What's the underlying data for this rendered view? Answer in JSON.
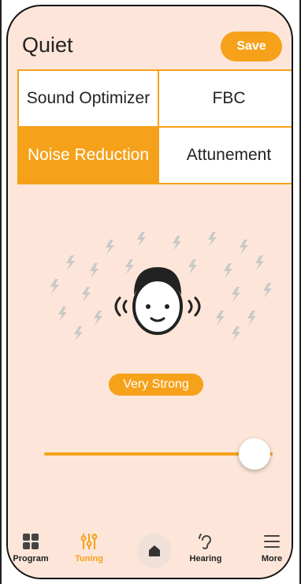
{
  "header": {
    "title": "Quiet",
    "save_label": "Save"
  },
  "options": [
    {
      "label": "Sound Optimizer",
      "active": false
    },
    {
      "label": "FBC",
      "active": false
    },
    {
      "label": "Noise Reduction",
      "active": true
    },
    {
      "label": "Attunement",
      "active": false
    }
  ],
  "level": {
    "label": "Very Strong",
    "slider_fraction": 0.92
  },
  "tabbar": {
    "items": [
      {
        "label": "Program",
        "icon": "grid-icon"
      },
      {
        "label": "Tuning",
        "icon": "sliders-icon",
        "active": true
      },
      {
        "label": "",
        "icon": "home-icon"
      },
      {
        "label": "Hearing",
        "icon": "ear-icon"
      },
      {
        "label": "More",
        "icon": "list-icon"
      }
    ]
  },
  "colors": {
    "accent": "#f6a11a",
    "background": "#fde6d9"
  }
}
